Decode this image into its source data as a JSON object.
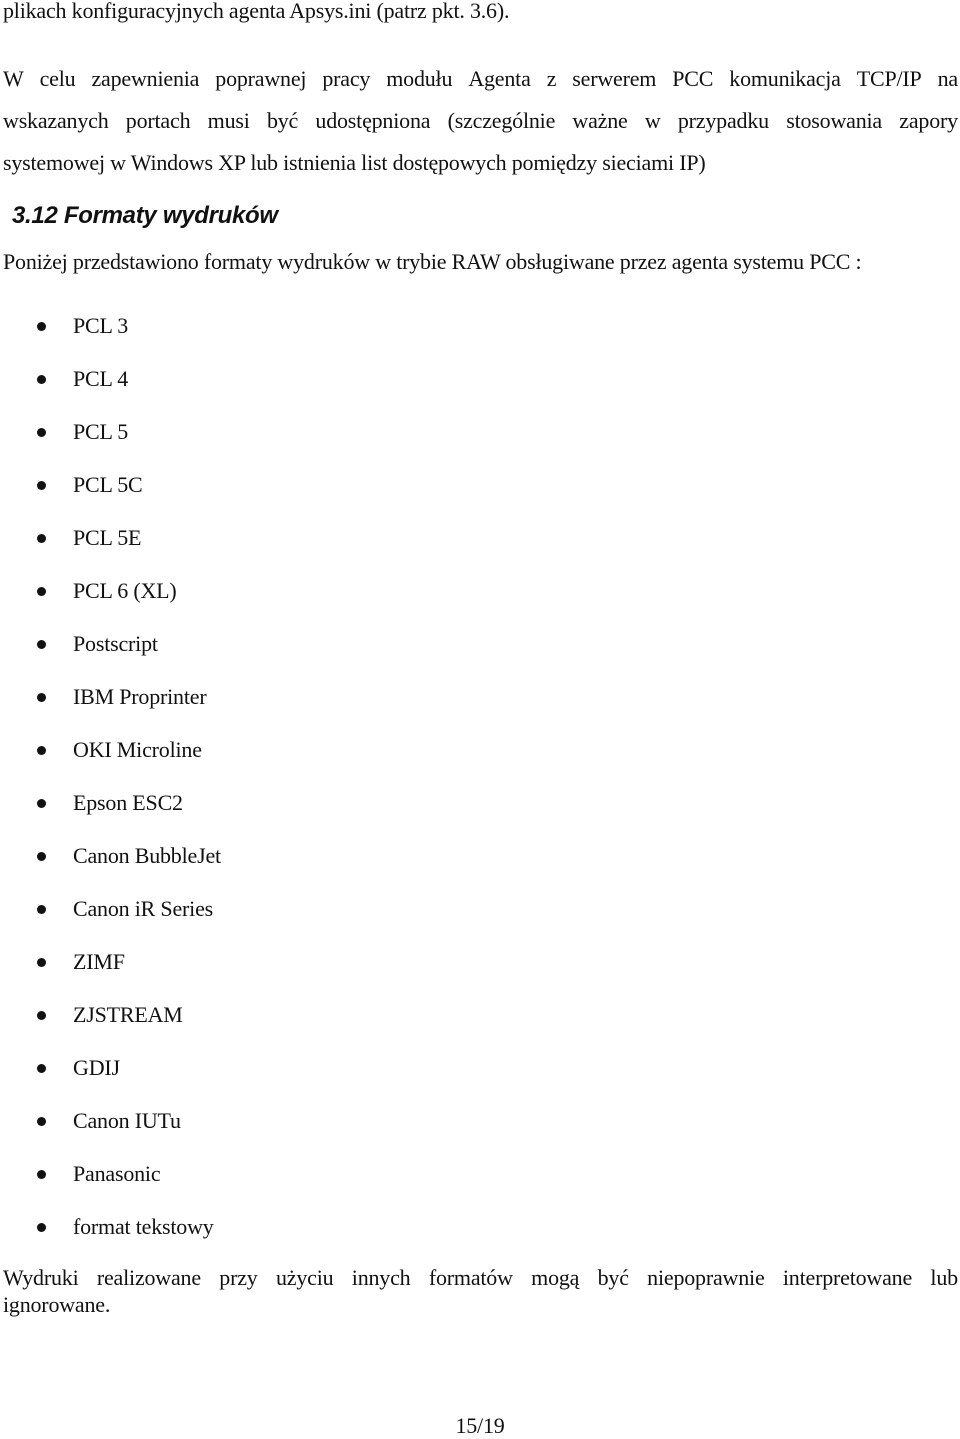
{
  "document": {
    "top_line": "plikach konfiguracyjnych agenta Apsys.ini (patrz pkt. 3.6).",
    "paragraph1_lines": [
      "W celu zapewnienia poprawnej pracy modułu Agenta z serwerem PCC komunikacja TCP/IP na",
      "wskazanych portach musi być udostępniona (szczególnie ważne w przypadku stosowania zapory",
      "systemowej w Windows XP lub istnienia list dostępowych pomiędzy sieciami IP)"
    ],
    "section_heading": "3.12 Formaty wydruków",
    "intro": "Poniżej przedstawiono formaty wydruków w trybie RAW obsługiwane przez agenta systemu PCC :",
    "formats": [
      "PCL 3",
      "PCL 4",
      "PCL 5",
      "PCL 5C",
      "PCL 5E",
      "PCL 6 (XL)",
      "Postscript",
      "IBM Proprinter",
      "OKI Microline",
      "Epson ESC2",
      "Canon BubbleJet",
      "Canon iR Series",
      "ZIMF",
      "ZJSTREAM",
      "GDIJ",
      "Canon IUTu",
      "Panasonic",
      "format tekstowy"
    ],
    "paragraph2_lines": [
      "Wydruki realizowane przy użyciu innych formatów mogą być niepoprawnie interpretowane lub",
      "ignorowane."
    ],
    "page_number": "15/19"
  }
}
